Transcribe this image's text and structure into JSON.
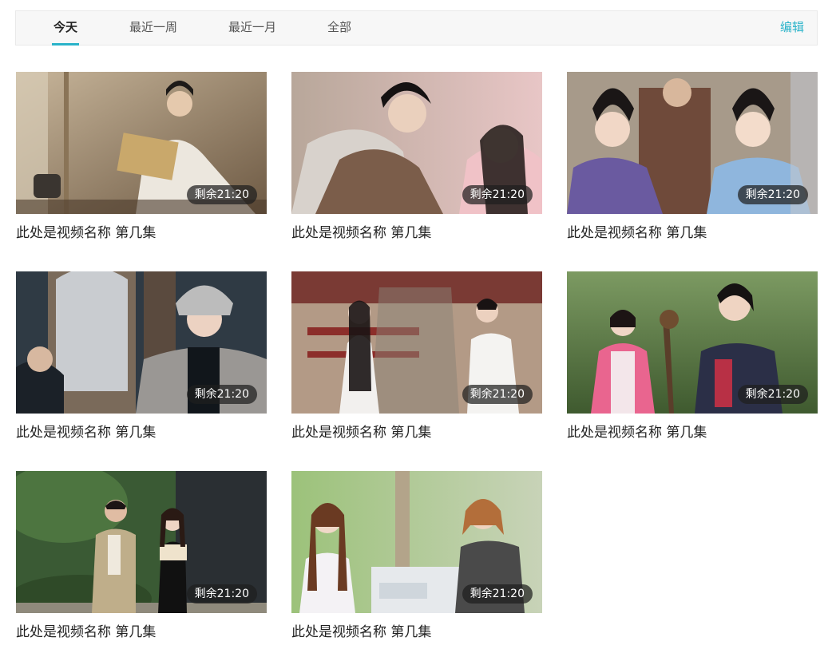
{
  "tabs": [
    {
      "label": "今天",
      "active": true
    },
    {
      "label": "最近一周",
      "active": false
    },
    {
      "label": "最近一月",
      "active": false
    },
    {
      "label": "全部",
      "active": false
    }
  ],
  "edit_label": "编辑",
  "accent_color": "#2ab3c9",
  "videos": [
    {
      "title": "此处是视频名称 第几集",
      "remaining": "剩余21:20",
      "scene": "warm-interior-scroll"
    },
    {
      "title": "此处是视频名称 第几集",
      "remaining": "剩余21:20",
      "scene": "couple-close-up"
    },
    {
      "title": "此处是视频名称 第几集",
      "remaining": "剩余21:20",
      "scene": "court-ladies"
    },
    {
      "title": "此处是视频名称 第几集",
      "remaining": "剩余21:20",
      "scene": "fur-hat-street"
    },
    {
      "title": "此处是视频名称 第几集",
      "remaining": "剩余21:20",
      "scene": "palace-terrace"
    },
    {
      "title": "此处是视频名称 第几集",
      "remaining": "剩余21:20",
      "scene": "forest-pair"
    },
    {
      "title": "此处是视频名称 第几集",
      "remaining": "剩余21:20",
      "scene": "garden-walk"
    },
    {
      "title": "此处是视频名称 第几集",
      "remaining": "剩余21:20",
      "scene": "street-conversation"
    }
  ]
}
